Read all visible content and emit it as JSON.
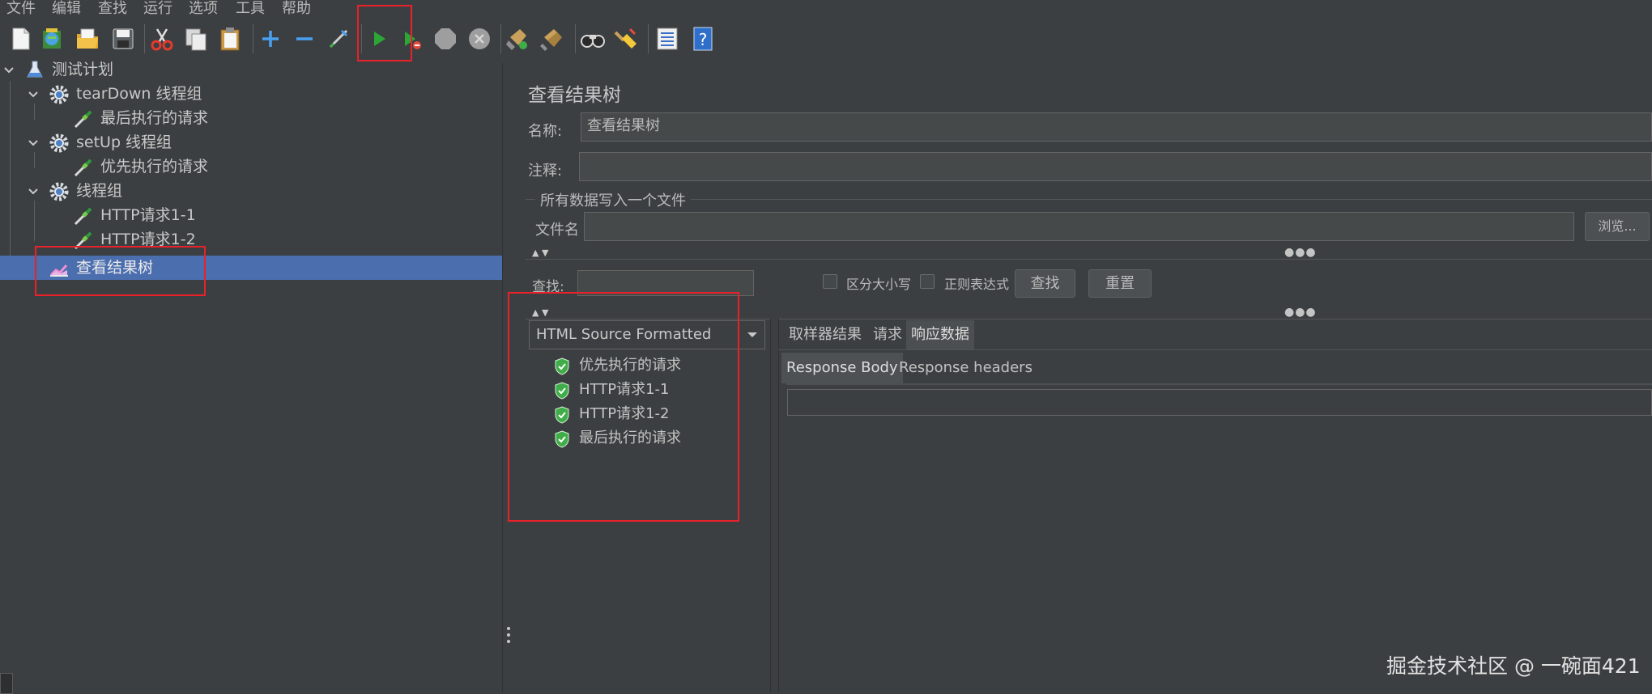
{
  "menu": [
    "文件",
    "编辑",
    "查找",
    "运行",
    "选项",
    "工具",
    "帮助"
  ],
  "toolbar": {
    "buttons": [
      "new-icon",
      "templates-icon",
      "open-icon",
      "save-icon",
      "cut-icon",
      "copy-icon",
      "paste-icon",
      "add-icon",
      "remove-icon",
      "toggle-icon",
      "start-icon",
      "start-no-pauses-icon",
      "stop-icon",
      "shutdown-icon",
      "clear-icon",
      "clear-all-icon",
      "search-icon",
      "reset-search-icon",
      "function-helper-icon",
      "help-icon"
    ]
  },
  "tree": {
    "root": "测试计划",
    "items": [
      {
        "label": "tearDown 线程组"
      },
      {
        "label": "最后执行的请求"
      },
      {
        "label": "setUp 线程组"
      },
      {
        "label": "优先执行的请求"
      },
      {
        "label": "线程组"
      },
      {
        "label": "HTTP请求1-1"
      },
      {
        "label": "HTTP请求1-2"
      },
      {
        "label": "查看结果树"
      }
    ]
  },
  "panel": {
    "title": "查看结果树",
    "name_label": "名称:",
    "name_value": "查看结果树",
    "comment_label": "注释:",
    "comment_value": "",
    "write_all_label": "所有数据写入一个文件",
    "filename_label": "文件名",
    "filename_value": "",
    "browse_label": "浏览..."
  },
  "search": {
    "label": "查找:",
    "value": "",
    "case_sensitive_label": "区分大小写",
    "regex_label": "正则表达式",
    "find_button": "查找",
    "reset_button": "重置"
  },
  "renderer": {
    "selected": "HTML Source Formatted"
  },
  "results": [
    {
      "label": "优先执行的请求",
      "status": "success"
    },
    {
      "label": "HTTP请求1-1",
      "status": "success"
    },
    {
      "label": "HTTP请求1-2",
      "status": "success"
    },
    {
      "label": "最后执行的请求",
      "status": "success"
    }
  ],
  "tabs": {
    "top": [
      "取样器结果",
      "请求",
      "响应数据"
    ],
    "top_active": "响应数据",
    "sub": [
      "Response Body",
      "Response headers"
    ],
    "sub_active": "Response Body"
  },
  "watermark": "掘金技术社区 @ 一碗面421",
  "colors": {
    "background": "#3c3f41",
    "selection": "#4b6eaf",
    "highlight_box": "#e8212a",
    "success_green": "#3fae49"
  }
}
